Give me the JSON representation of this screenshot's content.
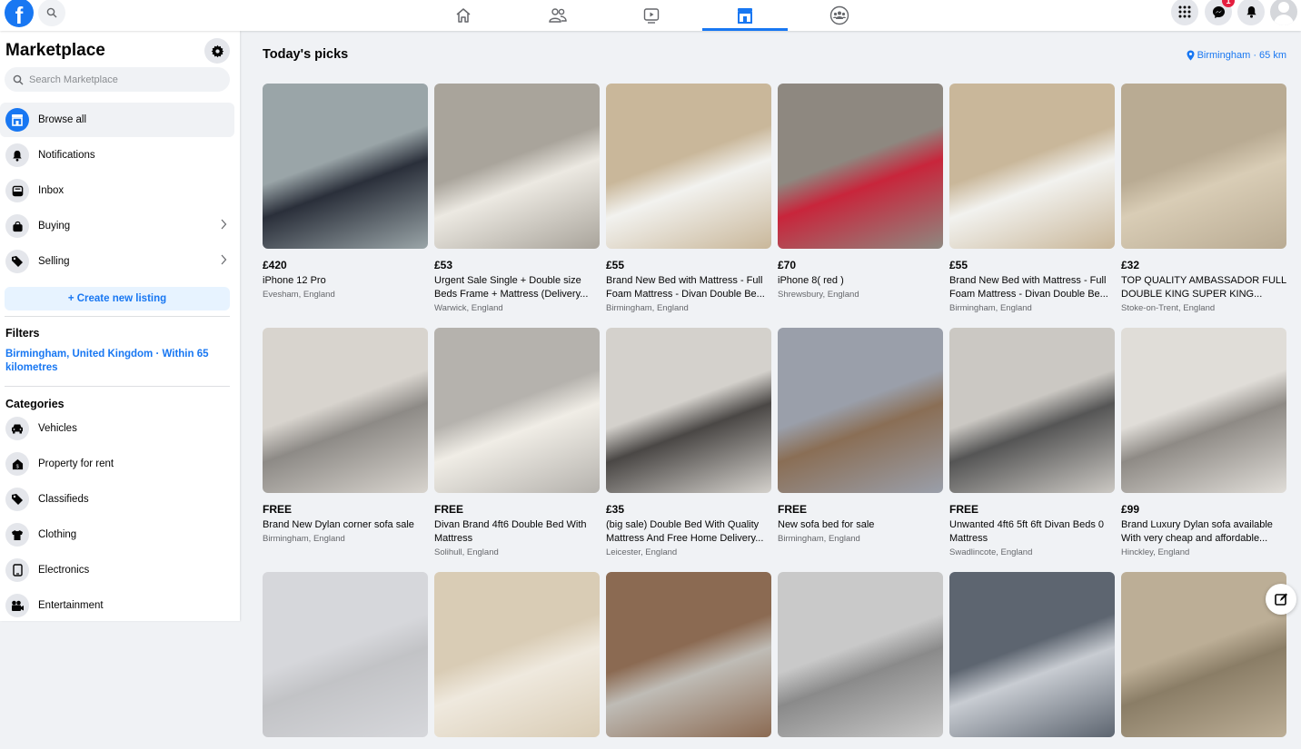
{
  "topbar": {
    "logo": "f",
    "nav_tabs": [
      {
        "name": "home",
        "icon": "home-icon",
        "active": false
      },
      {
        "name": "friends",
        "icon": "friends-icon",
        "active": false
      },
      {
        "name": "watch",
        "icon": "video-icon",
        "active": false
      },
      {
        "name": "marketplace",
        "icon": "marketplace-icon",
        "active": true
      },
      {
        "name": "groups",
        "icon": "groups-icon",
        "active": false
      }
    ],
    "messenger_badge": "1",
    "accent": "#1877f2"
  },
  "sidebar": {
    "title": "Marketplace",
    "search_placeholder": "Search Marketplace",
    "items": [
      {
        "label": "Browse all",
        "icon": "storefront-icon",
        "active": true
      },
      {
        "label": "Notifications",
        "icon": "bell-icon"
      },
      {
        "label": "Inbox",
        "icon": "inbox-icon"
      },
      {
        "label": "Buying",
        "icon": "shopping-bag-icon",
        "chevron": true
      },
      {
        "label": "Selling",
        "icon": "tag-icon",
        "chevron": true
      }
    ],
    "create_listing": "+ Create new listing",
    "filters_heading": "Filters",
    "filter_location": "Birmingham, United Kingdom · Within 65 kilometres",
    "categories_heading": "Categories",
    "categories": [
      {
        "label": "Vehicles",
        "icon": "car-icon"
      },
      {
        "label": "Property for rent",
        "icon": "house-icon"
      },
      {
        "label": "Classifieds",
        "icon": "tag-icon"
      },
      {
        "label": "Clothing",
        "icon": "shirt-icon"
      },
      {
        "label": "Electronics",
        "icon": "tablet-icon"
      },
      {
        "label": "Entertainment",
        "icon": "camera-icon"
      }
    ]
  },
  "main": {
    "title": "Today's picks",
    "location": "Birmingham · 65 km",
    "listings": [
      {
        "price": "£420",
        "title": "iPhone 12 Pro",
        "location": "Evesham, England",
        "colors": [
          "#9aa5a8",
          "#2a2f3a"
        ]
      },
      {
        "price": "£53",
        "title": "Urgent Sale Single + Double size Beds Frame + Mattress (Delivery...",
        "location": "Warwick, England",
        "colors": [
          "#a9a49b",
          "#ece9e2"
        ]
      },
      {
        "price": "£55",
        "title": "Brand New Bed with Mattress - Full Foam Mattress - Divan Double Be...",
        "location": "Birmingham, England",
        "colors": [
          "#c9b79a",
          "#f2f2ef"
        ]
      },
      {
        "price": "£70",
        "title": "iPhone 8( red )",
        "location": "Shrewsbury, England",
        "colors": [
          "#8e8880",
          "#c8253b"
        ]
      },
      {
        "price": "£55",
        "title": "Brand New Bed with Mattress - Full Foam Mattress - Divan Double Be...",
        "location": "Birmingham, England",
        "colors": [
          "#c9b79a",
          "#f2f2ef"
        ]
      },
      {
        "price": "£32",
        "title": "TOP QUALITY AMBASSADOR FULL DOUBLE KING SUPER KING...",
        "location": "Stoke-on-Trent, England",
        "colors": [
          "#b9ab93",
          "#d9cdb6"
        ]
      },
      {
        "price": "FREE",
        "title": "Brand New Dylan corner sofa sale",
        "location": "Birmingham, England",
        "colors": [
          "#d8d4ce",
          "#8d8a86"
        ]
      },
      {
        "price": "FREE",
        "title": "Divan Brand 4ft6 Double Bed With Mattress",
        "location": "Solihull, England",
        "colors": [
          "#b5b2ad",
          "#f0ede6"
        ]
      },
      {
        "price": "£35",
        "title": "(big sale) Double Bed With Quality Mattress And Free Home Delivery...",
        "location": "Leicester, England",
        "colors": [
          "#d4d1cc",
          "#4a4745"
        ]
      },
      {
        "price": "FREE",
        "title": "New sofa bed for sale",
        "location": "Birmingham, England",
        "colors": [
          "#9a9faa",
          "#8a6e55"
        ]
      },
      {
        "price": "FREE",
        "title": "Unwanted 4ft6 5ft 6ft Divan Beds 0 Mattress",
        "location": "Swadlincote, England",
        "colors": [
          "#cbc8c3",
          "#555"
        ]
      },
      {
        "price": "£99",
        "title": "Brand Luxury Dylan sofa available With very cheap and affordable...",
        "location": "Hinckley, England",
        "colors": [
          "#e0ddd8",
          "#8e8a85"
        ]
      },
      {
        "price": "",
        "title": "",
        "location": "",
        "colors": [
          "#d6d7db",
          "#c2c3c6"
        ]
      },
      {
        "price": "",
        "title": "",
        "location": "",
        "colors": [
          "#d9ccb5",
          "#efe9de"
        ]
      },
      {
        "price": "",
        "title": "",
        "location": "",
        "colors": [
          "#8b6a52",
          "#bfbcb6"
        ]
      },
      {
        "price": "",
        "title": "",
        "location": "",
        "colors": [
          "#c9c9c9",
          "#8a8a8a"
        ]
      },
      {
        "price": "",
        "title": "",
        "location": "",
        "colors": [
          "#5d6570",
          "#c8ccd2"
        ]
      },
      {
        "price": "",
        "title": "",
        "location": "",
        "colors": [
          "#bcae96",
          "#8a7d66"
        ]
      }
    ]
  }
}
